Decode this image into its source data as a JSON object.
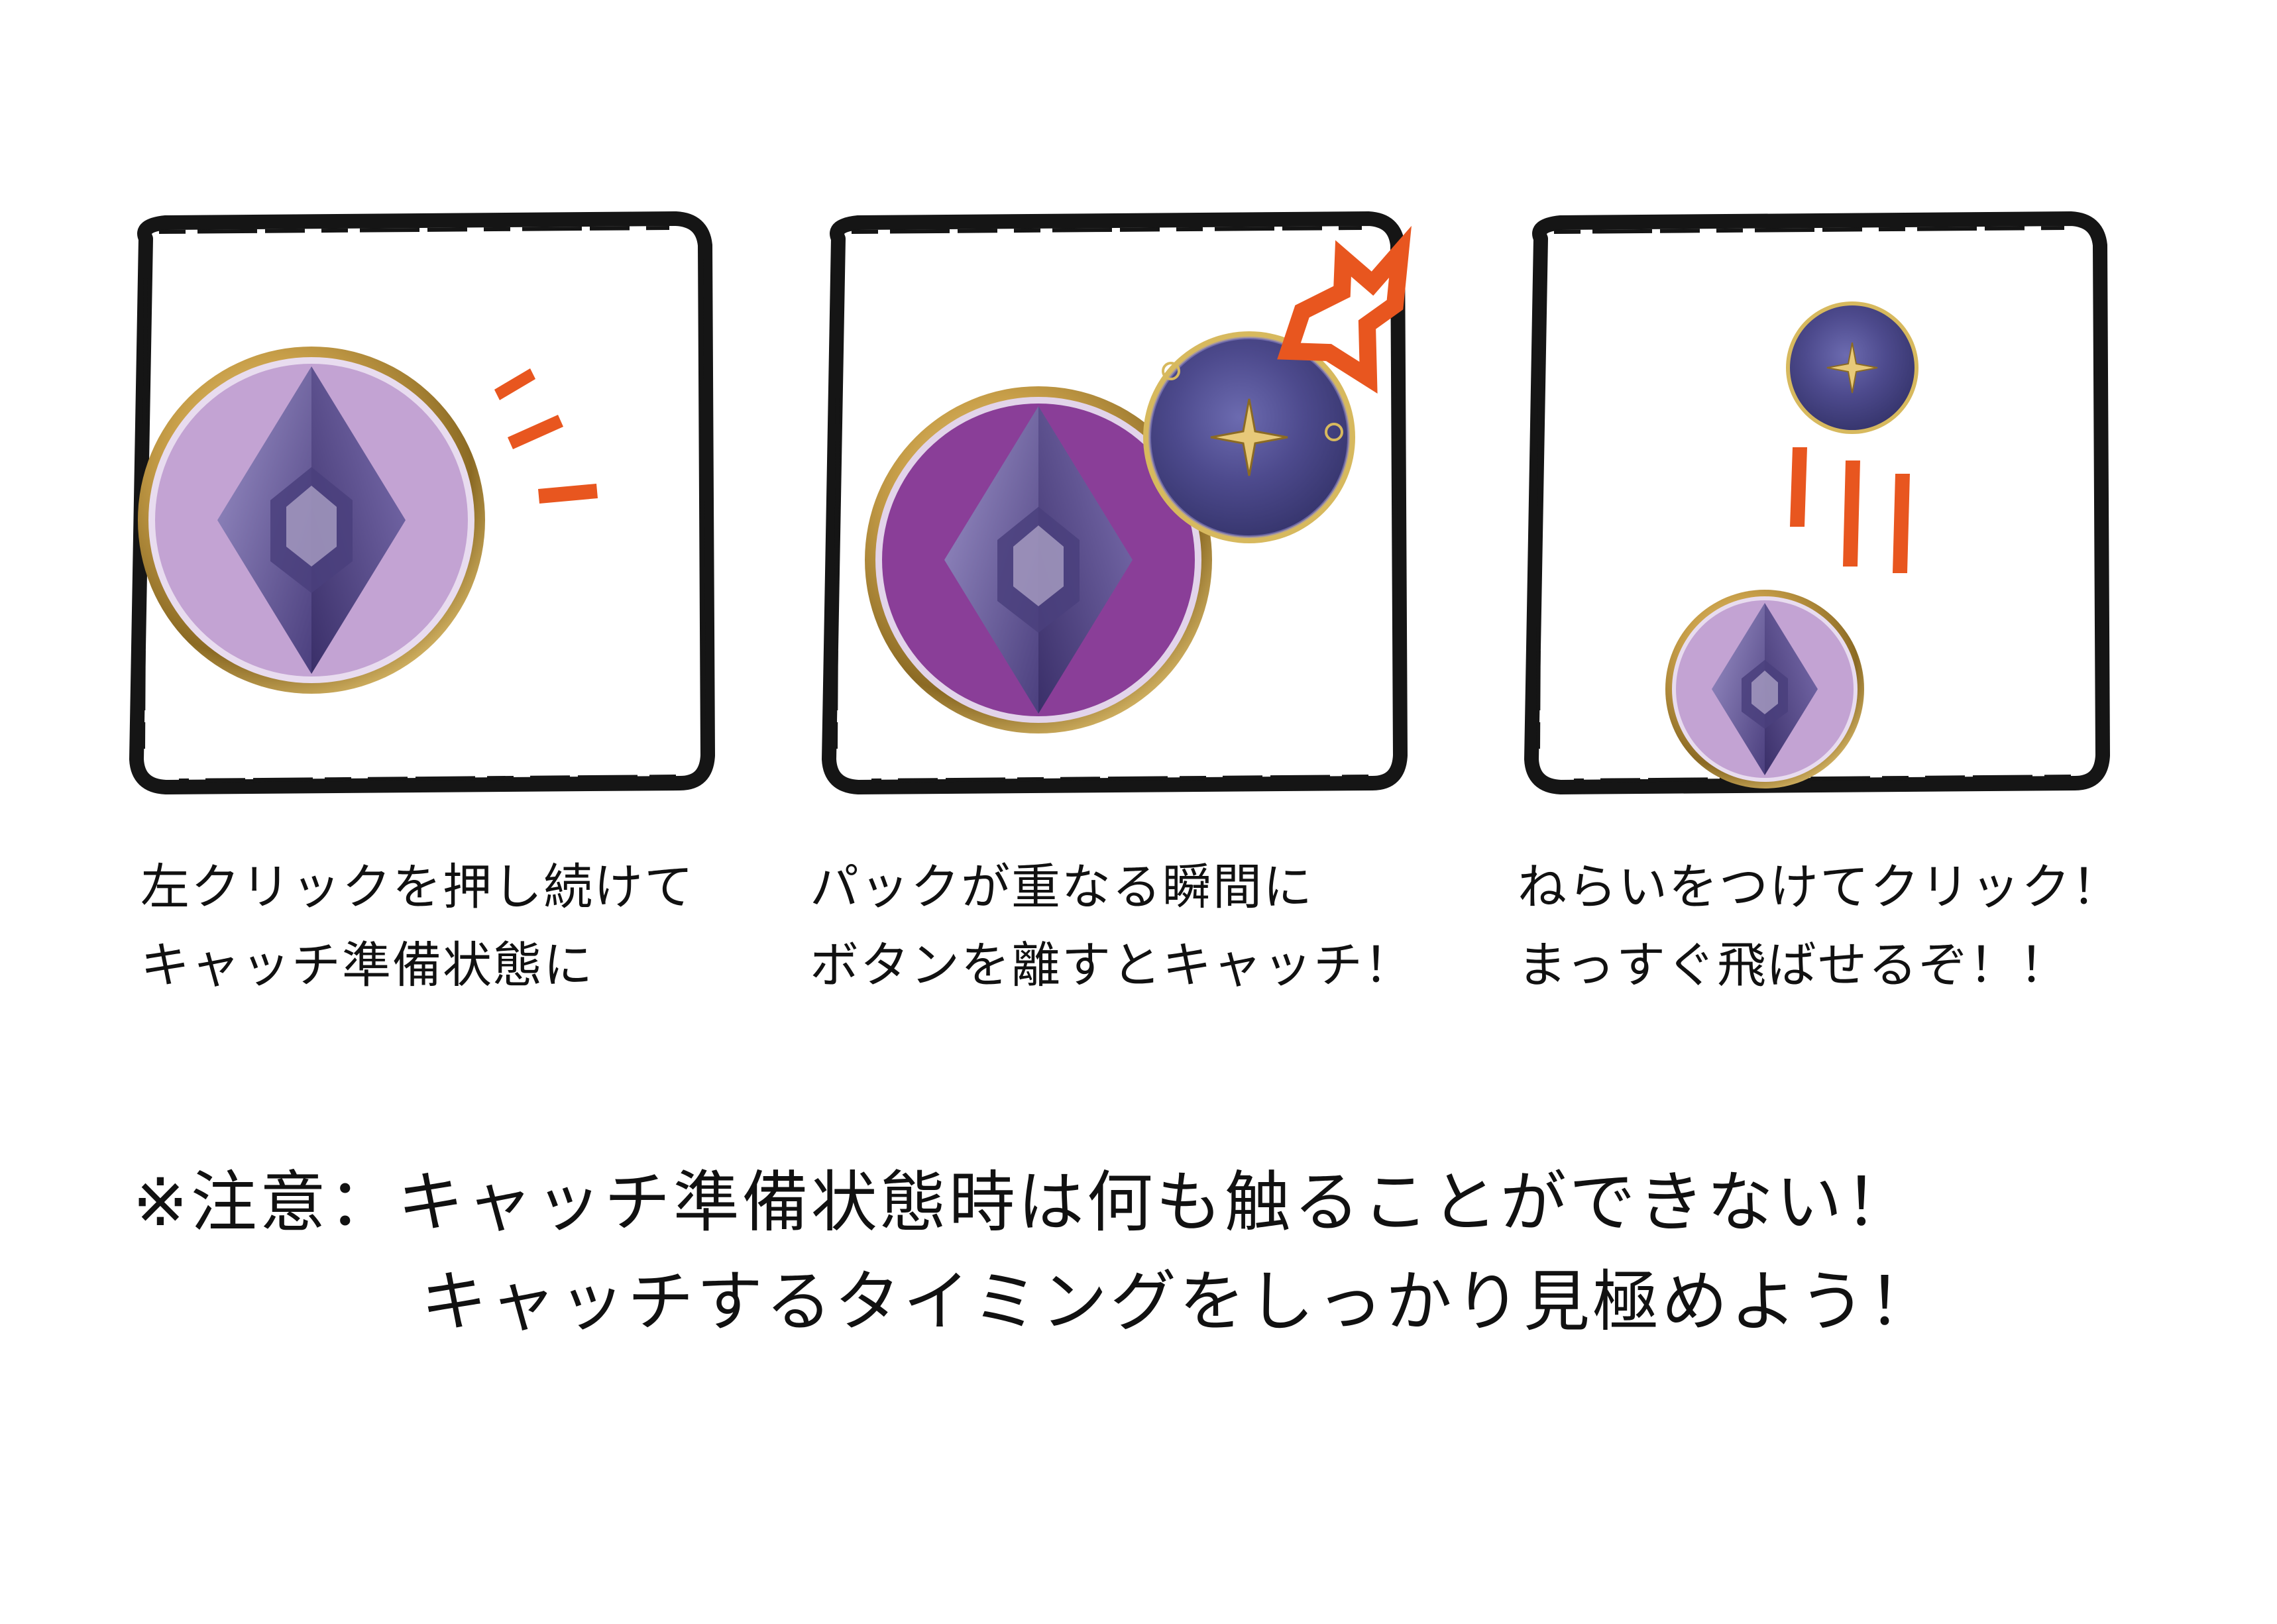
{
  "colors": {
    "frame": "#151515",
    "accent": "#e8561f",
    "puck_light": "#c3a3d3",
    "puck_dark": "#8a3e98",
    "gold": "#c9a04a",
    "crystal": "#5a4d8e"
  },
  "icons": {
    "frame": "rough-square-frame",
    "puck": "crystal-puck-icon",
    "disc": "opponent-disc-icon",
    "flash": "impact-flash-icon"
  },
  "panels": [
    {
      "id": "ready",
      "caption": [
        "左クリックを押し続けて",
        "キャッチ準備状態に"
      ]
    },
    {
      "id": "catch",
      "caption": [
        "パックが重なる瞬間に",
        "ボタンを離すとキャッチ！"
      ]
    },
    {
      "id": "throw",
      "caption": [
        "ねらいをつけてクリック！",
        "まっすぐ飛ばせるぞ！！"
      ]
    }
  ],
  "notice": {
    "line1": "※注意：キャッチ準備状態時は何も触ることができない！",
    "line2": "キャッチするタイミングをしっかり見極めよう！"
  }
}
